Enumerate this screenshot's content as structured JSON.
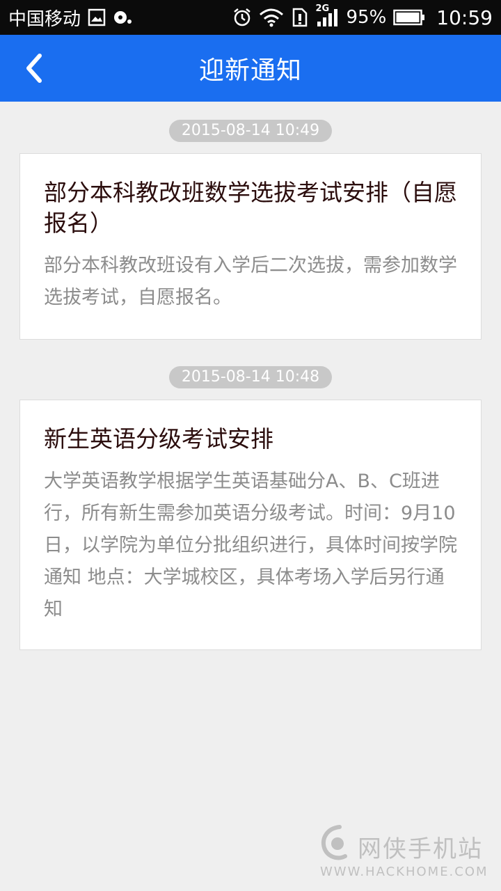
{
  "status_bar": {
    "carrier": "中国移动",
    "network": "2G",
    "battery": "95%",
    "time": "10:59",
    "icons": [
      "image-icon",
      "media-icon",
      "alarm-icon",
      "wifi-icon",
      "sim-alert-icon",
      "signal-icon",
      "battery-icon"
    ]
  },
  "header": {
    "title": "迎新通知",
    "back_icon": "chevron-left-icon",
    "background": "#1a6ef0"
  },
  "notices": [
    {
      "time": "2015-08-14 10:49",
      "title": "部分本科教改班数学选拔考试安排（自愿报名）",
      "body": "部分本科教改班设有入学后二次选拔，需参加数学选拔考试，自愿报名。"
    },
    {
      "time": "2015-08-14 10:48",
      "title": "新生英语分级考试安排",
      "body": "大学英语教学根据学生英语基础分A、B、C班进行，所有新生需参加英语分级考试。时间：9月10日，以学院为单位分批组织进行，具体时间按学院通知 地点：大学城校区，具体考场入学后另行通知"
    }
  ],
  "watermark": {
    "name": "网侠手机站",
    "url": "WWW.HACKHOME.COM"
  }
}
